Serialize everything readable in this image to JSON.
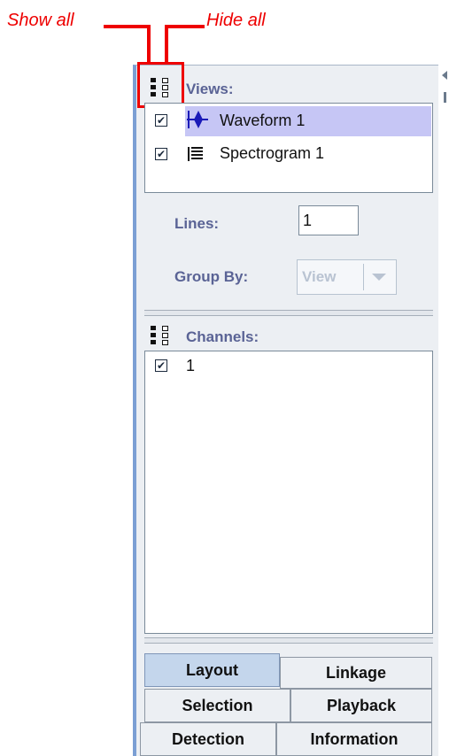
{
  "callouts": {
    "show_all": "Show all",
    "hide_all": "Hide all"
  },
  "views": {
    "title": "Views:",
    "items": [
      {
        "label": "Waveform 1",
        "checked": true,
        "selected": true,
        "icon": "waveform-icon"
      },
      {
        "label": "Spectrogram 1",
        "checked": true,
        "selected": false,
        "icon": "spectrogram-icon"
      }
    ]
  },
  "lines": {
    "label": "Lines:",
    "value": "1"
  },
  "group_by": {
    "label": "Group By:",
    "value": "View"
  },
  "channels": {
    "title": "Channels:",
    "items": [
      {
        "label": "1",
        "checked": true
      }
    ]
  },
  "tabs": {
    "row1": [
      "Layout",
      "Linkage"
    ],
    "row2": [
      "Selection",
      "Playback"
    ],
    "row3": [
      "Detection",
      "Information"
    ],
    "active": "Layout"
  },
  "colors": {
    "callout": "#ee0000",
    "section_title": "#5a6395",
    "selection": "#c6c6f5",
    "active_tab": "#c4d6ec"
  }
}
